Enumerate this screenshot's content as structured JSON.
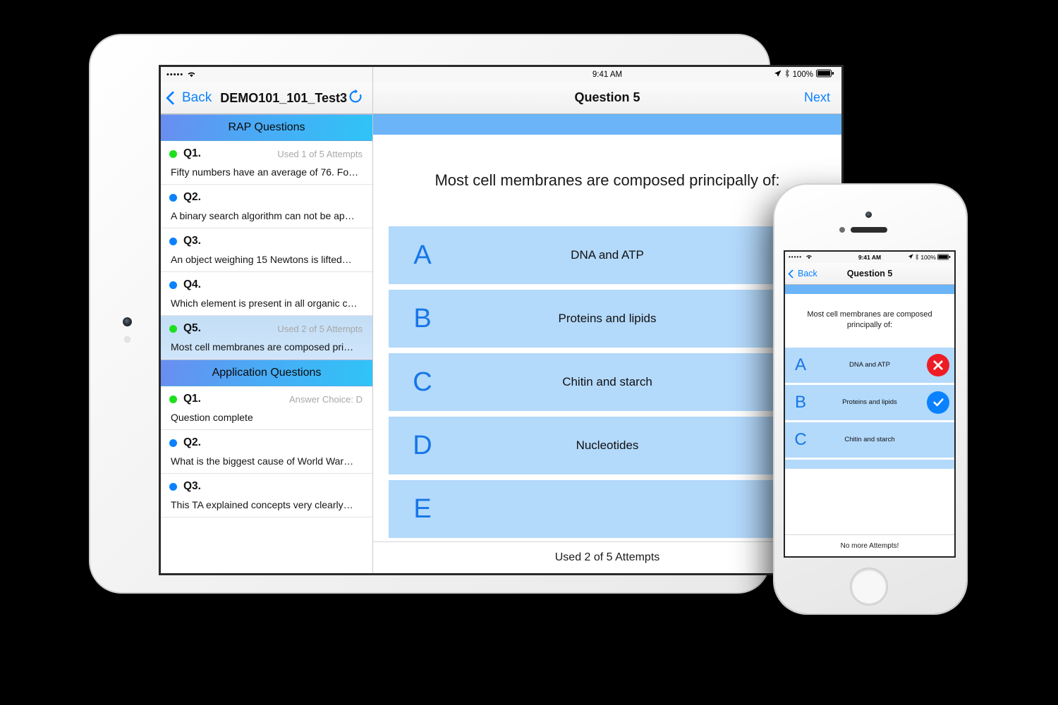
{
  "ipad": {
    "status_left_dots": "•••••",
    "status_time": "9:41 AM",
    "status_battery_pct": "100%",
    "sidebar": {
      "back_label": "Back",
      "title": "DEMO101_101_Test3",
      "refresh_icon": "refresh-icon",
      "sections": [
        {
          "header": "RAP Questions",
          "items": [
            {
              "id": "Q1.",
              "status": "green",
              "meta": "Used 1 of 5 Attempts",
              "text": "Fifty numbers have an average of 76. Fo…",
              "selected": false
            },
            {
              "id": "Q2.",
              "status": "blue",
              "meta": "",
              "text": "A binary search algorithm can not be ap…",
              "selected": false
            },
            {
              "id": "Q3.",
              "status": "blue",
              "meta": "",
              "text": "An object weighing 15 Newtons is lifted…",
              "selected": false
            },
            {
              "id": "Q4.",
              "status": "blue",
              "meta": "",
              "text": "Which element is present in all organic c…",
              "selected": false
            },
            {
              "id": "Q5.",
              "status": "green",
              "meta": "Used 2 of 5 Attempts",
              "text": "Most cell membranes are composed pri…",
              "selected": true
            }
          ]
        },
        {
          "header": "Application Questions",
          "items": [
            {
              "id": "Q1.",
              "status": "green",
              "meta": "Answer Choice: D",
              "text": "Question complete",
              "selected": false
            },
            {
              "id": "Q2.",
              "status": "blue",
              "meta": "",
              "text": "What is the biggest cause of World War…",
              "selected": false
            },
            {
              "id": "Q3.",
              "status": "blue",
              "meta": "",
              "text": "This TA explained concepts very clearly…",
              "selected": false
            }
          ]
        }
      ]
    },
    "detail": {
      "nav_title": "Question 5",
      "next_label": "Next",
      "question": "Most cell membranes are composed principally of:",
      "options": [
        {
          "letter": "A",
          "text": "DNA and ATP",
          "mark": "x"
        },
        {
          "letter": "B",
          "text": "Proteins and lipids",
          "mark": "ok"
        },
        {
          "letter": "C",
          "text": "Chitin and starch",
          "mark": "none"
        },
        {
          "letter": "D",
          "text": "Nucleotides",
          "mark": "none"
        },
        {
          "letter": "E",
          "text": "",
          "mark": "none"
        }
      ],
      "footer": "Used 2 of 5 Attempts"
    }
  },
  "iphone": {
    "status_left_dots": "•••••",
    "status_time": "9:41 AM",
    "status_battery_pct": "100%",
    "back_label": "Back",
    "nav_title": "Question 5",
    "question": "Most cell membranes are composed principally of:",
    "options": [
      {
        "letter": "A",
        "text": "DNA and ATP",
        "mark": "x"
      },
      {
        "letter": "B",
        "text": "Proteins and lipids",
        "mark": "ok"
      },
      {
        "letter": "C",
        "text": "Chitin and starch",
        "mark": "none"
      }
    ],
    "footer": "No more Attempts!"
  },
  "colors": {
    "accent_blue": "#0a82ff",
    "option_blue": "#b3d9fb",
    "bar_blue": "#6ab4f7",
    "wrong_red": "#ee1c25",
    "status_green": "#1ee01e"
  }
}
